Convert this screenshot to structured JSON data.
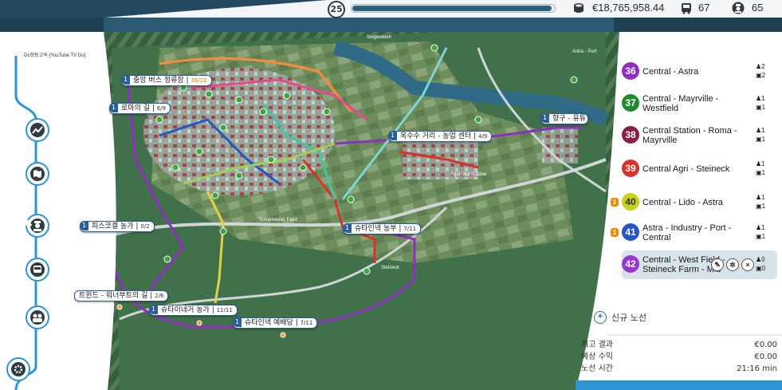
{
  "topbar": {
    "level": "25",
    "xp_progress": 0.99,
    "money": "€18,765,958.44",
    "buses": "67",
    "staff": "65"
  },
  "sidebar": {
    "title": "Do형동고속-[YouTube TV Do]",
    "buttons": [
      "stats-icon",
      "map-icon",
      "driver-icon",
      "bus-icon",
      "people-icon",
      "settings-icon"
    ]
  },
  "map": {
    "place_names": [
      "Siegwalden",
      "Schartweiler Field",
      "Agricultural Zone",
      "Steineck",
      "Astra - Port"
    ],
    "labels": [
      {
        "num": "1",
        "name": "중앙 버스 정류장",
        "count": "26/22",
        "warn": true
      },
      {
        "num": "1",
        "name": "로마의 길",
        "count": "6/9"
      },
      {
        "num": "1",
        "name": "옥수수 거리 - 농업 센터",
        "count": "4/9"
      },
      {
        "num": "1",
        "name": "항구 - 유튜",
        "count": ""
      },
      {
        "num": "1",
        "name": "피스코겔 농가",
        "count": "0/2"
      },
      {
        "num": "1",
        "name": "슈타인넥 농부",
        "count": "7/11"
      },
      {
        "num": "",
        "name": "트윈드 - 워너부트의 길",
        "count": "2/6"
      },
      {
        "num": "1",
        "name": "슈타이네거 농가",
        "count": "11/11"
      },
      {
        "num": "1",
        "name": "슈타인넥 예배당",
        "count": "7/11"
      }
    ]
  },
  "lines": [
    {
      "num": "36",
      "name": "Central - Astra",
      "color": "#8e2fbf",
      "stops": "2",
      "buses": "2",
      "warn": ""
    },
    {
      "num": "37",
      "name": "Central - Mayrville - Westfield",
      "color": "#1f8a2e",
      "stops": "1",
      "buses": "1",
      "warn": ""
    },
    {
      "num": "38",
      "name": "Central Station - Roma - Mayrville",
      "color": "#8c1f47",
      "stops": "1",
      "buses": "1",
      "warn": ""
    },
    {
      "num": "39",
      "name": "Central Agri - Steineck",
      "color": "#d8332b",
      "stops": "1",
      "buses": "1",
      "warn": ""
    },
    {
      "num": "40",
      "name": "Central - Lido - Astra",
      "color": "#c8d21c",
      "stops": "1",
      "buses": "1",
      "warn": "1"
    },
    {
      "num": "41",
      "name": "Astra - Industry - Port - Central",
      "color": "#2457c4",
      "stops": "1",
      "buses": "1",
      "warn": "1"
    },
    {
      "num": "42",
      "name": "Central - West Field - Steineck Farm - Mid",
      "color": "#9a35d6",
      "stops": "0",
      "buses": "0",
      "warn": ""
    }
  ],
  "new_line_label": "신규 노선",
  "stats": [
    {
      "label": "최고 결과",
      "value": "€0.00"
    },
    {
      "label": "예상 수익",
      "value": "€0.00"
    },
    {
      "label": "노선 시간",
      "value": "21:16 min"
    }
  ],
  "colors": {
    "accent": "#2b95d6",
    "map_forest": "#2f5e3a",
    "map_field": "#7b9a6a"
  }
}
